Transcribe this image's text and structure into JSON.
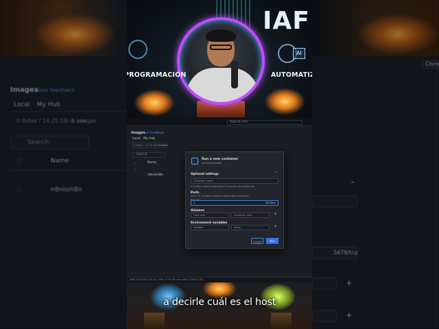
{
  "video": {
    "brand": "IAF",
    "left_label": "PROGRAMACIÓN",
    "right_label": "AUTOMATIZ",
    "ai_chip": "AI",
    "caption": "a decirle cuál es el host"
  },
  "background": {
    "images_title": "Images",
    "give_feedback": "Give feedback",
    "tab_local": "Local",
    "tab_hub": "My Hub",
    "usage": "0 Bytes / 14.25 GB in use",
    "images_count": "1 images",
    "search_placeholder": "Search",
    "col_name": "Name",
    "row_name": "n8nio/n8n",
    "right_button": "Chrome",
    "port_value": "5678/tcp"
  },
  "app": {
    "search_placeholder": "Search /ctrl",
    "images_title": "Images",
    "give_feedback": "Give feedback",
    "tab_local": "Local",
    "tab_hub": "My Hub",
    "usage": "0 Bytes / 14.25 GB in use",
    "images_count": "1 images",
    "search": "Search",
    "col_name": "Name",
    "row_name": "n8nio/n8n",
    "status_text": "RAM 28.56 GB 0.00 GB · Disk 23.55 GB used (limit 1006.85 GB)"
  },
  "modal": {
    "title": "Run a new container",
    "subtitle": "n8nio/n8n:latest",
    "optional_settings": "Optional settings",
    "container_name_placeholder": "Container name",
    "container_name_help": "A random name is generated if you do not provide one.",
    "ports_title": "Ports",
    "ports_help": "Enter '0' to assign randomly generated host ports.",
    "host_port_label": "Host port",
    "host_port_value": "0",
    "container_port": "5678/tcp",
    "volumes_title": "Volumes",
    "host_path_placeholder": "Host path",
    "container_path_placeholder": "Container path",
    "env_title": "Environment variables",
    "variable_placeholder": "Variable",
    "value_placeholder": "Value",
    "cancel": "Cancel",
    "run": "Run"
  }
}
